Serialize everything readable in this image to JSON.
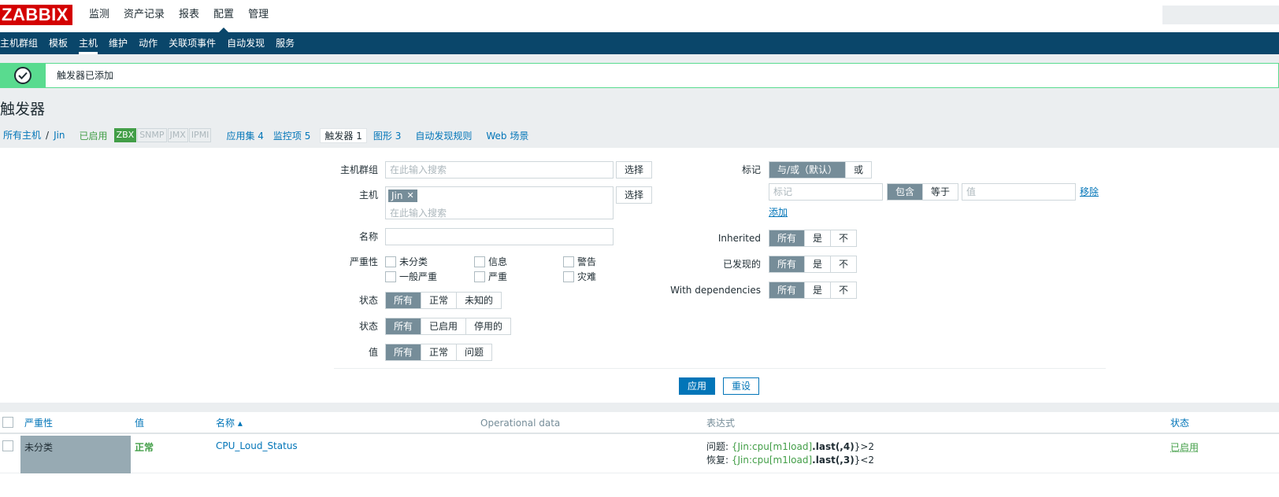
{
  "app": {
    "logo": "ZABBIX"
  },
  "top_nav": [
    "监测",
    "资产记录",
    "报表",
    "配置",
    "管理"
  ],
  "top_nav_active": "配置",
  "sub_nav": [
    "主机群组",
    "模板",
    "主机",
    "维护",
    "动作",
    "关联项事件",
    "自动发现",
    "服务"
  ],
  "sub_nav_active": "主机",
  "message": {
    "text": "触发器已添加"
  },
  "page": {
    "title": "触发器"
  },
  "breadcrumb": {
    "all_hosts": "所有主机",
    "separator": "/",
    "host": "Jin",
    "status": "已启用",
    "tags": [
      "ZBX",
      "SNMP",
      "JMX",
      "IPMI"
    ],
    "tabs": [
      {
        "label": "应用集",
        "count": "4"
      },
      {
        "label": "监控项",
        "count": "5"
      },
      {
        "label": "触发器",
        "count": "1"
      },
      {
        "label": "图形",
        "count": "3"
      },
      {
        "label": "自动发现规则",
        "count": ""
      },
      {
        "label": "Web 场景",
        "count": ""
      }
    ]
  },
  "filter": {
    "host_group_label": "主机群组",
    "host_group_placeholder": "在此输入搜索",
    "select_label": "选择",
    "host_label": "主机",
    "host_chip": "Jin",
    "host_placeholder": "在此输入搜索",
    "name_label": "名称",
    "severity_label": "严重性",
    "severities": [
      "未分类",
      "信息",
      "警告",
      "一般严重",
      "严重",
      "灾难"
    ],
    "state_label": "状态",
    "state_options": [
      "所有",
      "正常",
      "未知的"
    ],
    "status_label": "状态",
    "status_options": [
      "所有",
      "已启用",
      "停用的"
    ],
    "value_label": "值",
    "value_options": [
      "所有",
      "正常",
      "问题"
    ],
    "tags_label": "标记",
    "tags_mode": [
      "与/或（默认）",
      "或"
    ],
    "tag_placeholder": "标记",
    "tag_ops": [
      "包含",
      "等于"
    ],
    "tag_value_placeholder": "值",
    "remove_label": "移除",
    "add_label": "添加",
    "inherited_label": "Inherited",
    "inherited_options": [
      "所有",
      "是",
      "不"
    ],
    "discovered_label": "已发现的",
    "discovered_options": [
      "所有",
      "是",
      "不"
    ],
    "deps_label": "With dependencies",
    "deps_options": [
      "所有",
      "是",
      "不"
    ],
    "apply_label": "应用",
    "reset_label": "重设"
  },
  "table": {
    "headers": {
      "severity": "严重性",
      "value": "值",
      "name": "名称 ▴",
      "operational": "Operational data",
      "expression": "表达式",
      "status": "状态"
    },
    "rows": [
      {
        "severity": "未分类",
        "value": "正常",
        "name": "CPU_Loud_Status",
        "problem_prefix": "问题: ",
        "problem_item": "{Jin:cpu[m1load]",
        "problem_func": ".last(,4)",
        "problem_suffix": "}>2",
        "recovery_prefix": "恢复: ",
        "recovery_item": "{Jin:cpu[m1load]",
        "recovery_func": ".last(,3)",
        "recovery_suffix": "}<2",
        "status": "已启用"
      }
    ]
  },
  "colors": {
    "brand": "#d40000",
    "nav": "#0a466a",
    "success": "#59db8f",
    "link": "#0275b8",
    "enabled": "#429e47"
  }
}
